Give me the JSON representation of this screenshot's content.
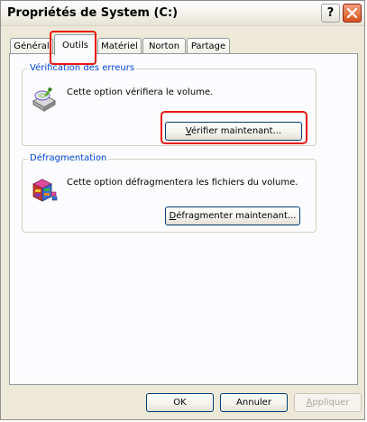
{
  "window": {
    "title": "Propriétés de System (C:)",
    "help_label": "?"
  },
  "tabs": [
    {
      "label": "Général"
    },
    {
      "label": "Outils"
    },
    {
      "label": "Matériel"
    },
    {
      "label": "Norton"
    },
    {
      "label": "Partage"
    }
  ],
  "active_tab": "Outils",
  "error_check": {
    "label": "Vérification des erreurs",
    "text": "Cette option vérifiera le volume.",
    "button_first": "V",
    "button_rest": "érifier maintenant...",
    "icon": "disk-check-icon"
  },
  "defrag": {
    "label": "Défragmentation",
    "text": "Cette option défragmentera les fichiers du volume.",
    "button_first": "D",
    "button_rest": "éfragmenter maintenant...",
    "icon": "defrag-icon"
  },
  "footer": {
    "ok": "OK",
    "cancel": "Annuler",
    "apply_first": "A",
    "apply_rest": "ppliquer"
  },
  "colors": {
    "highlight": "#e8180e",
    "group_label": "#0046d5",
    "close_button": "#d9521f"
  }
}
